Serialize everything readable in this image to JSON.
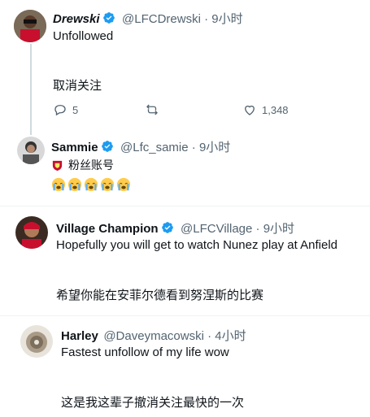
{
  "tweets": [
    {
      "name": "Drewski",
      "handle": "@LFCDrewski",
      "time": "9小时",
      "lines": [
        "Unfollowed",
        "取消关注"
      ],
      "actions": {
        "replies": "5",
        "likes": "1,348"
      }
    },
    {
      "name": "Sammie",
      "handle": "@Lfc_samie",
      "time": "9小时",
      "tag_label": "粉丝账号",
      "emoji_count_note": "",
      "emojis": [
        "crying-face",
        "crying-face",
        "crying-face",
        "crying-face",
        "crying-face"
      ]
    },
    {
      "name": "Village Champion",
      "handle": "@LFCVillage",
      "time": "9小时",
      "lines": [
        "Hopefully you will get to watch Nunez play at Anfield",
        "希望你能在安菲尔德看到努涅斯的比赛"
      ]
    },
    {
      "name": "Harley",
      "handle": "@Daveymacowski",
      "time": "4小时",
      "lines": [
        "Fastest unfollow of my life wow",
        "这是我这辈子撤消关注最快的一次"
      ]
    }
  ],
  "separator": " · ",
  "colors": {
    "verified": "#1d9bf0",
    "meta": "#536471",
    "text": "#0f1419",
    "liverpool_red": "#c8102e"
  }
}
